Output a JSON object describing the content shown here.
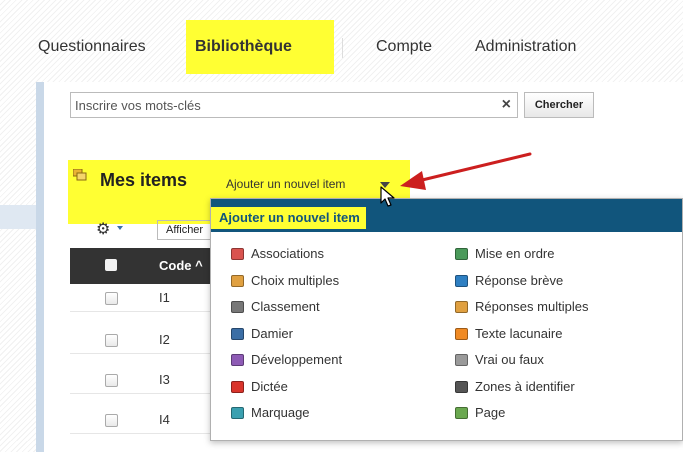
{
  "nav": {
    "items": [
      {
        "label": "Questionnaires"
      },
      {
        "label": "Bibliothèque"
      },
      {
        "label": "Compte"
      },
      {
        "label": "Administration"
      }
    ]
  },
  "search": {
    "placeholder": "Inscrire vos mots-clés",
    "clear_icon": "×",
    "button_label": "Chercher"
  },
  "section": {
    "title": "Mes items",
    "add_link": "Ajouter un nouvel item",
    "show_label": "Afficher"
  },
  "table": {
    "header_code": "Code ^",
    "rows": [
      {
        "code": "I1"
      },
      {
        "code": "I2"
      },
      {
        "code": "I3"
      },
      {
        "code": "I4"
      }
    ]
  },
  "menu": {
    "header": "Ajouter un nouvel item",
    "left": [
      {
        "label": "Associations",
        "color": "#d9534f"
      },
      {
        "label": "Choix multiples",
        "color": "#e0a040"
      },
      {
        "label": "Classement",
        "color": "#777777"
      },
      {
        "label": "Damier",
        "color": "#3b6ea5"
      },
      {
        "label": "Développement",
        "color": "#8e5bb5"
      },
      {
        "label": "Dictée",
        "color": "#d9342b"
      },
      {
        "label": "Marquage",
        "color": "#3aa0b0"
      }
    ],
    "right": [
      {
        "label": "Mise en ordre",
        "color": "#4a9a5a"
      },
      {
        "label": "Réponse brève",
        "color": "#2e7fc2"
      },
      {
        "label": "Réponses multiples",
        "color": "#e0a040"
      },
      {
        "label": "Texte lacunaire",
        "color": "#f08a24"
      },
      {
        "label": "Vrai ou faux",
        "color": "#9a9a9a"
      },
      {
        "label": "Zones à identifier",
        "color": "#555555"
      },
      {
        "label": "Page",
        "color": "#6aa84f"
      }
    ]
  },
  "colors": {
    "highlight": "#ffff33",
    "menu_header": "#11557c",
    "table_header": "#333333",
    "annotation_arrow": "#cc1f1f"
  }
}
